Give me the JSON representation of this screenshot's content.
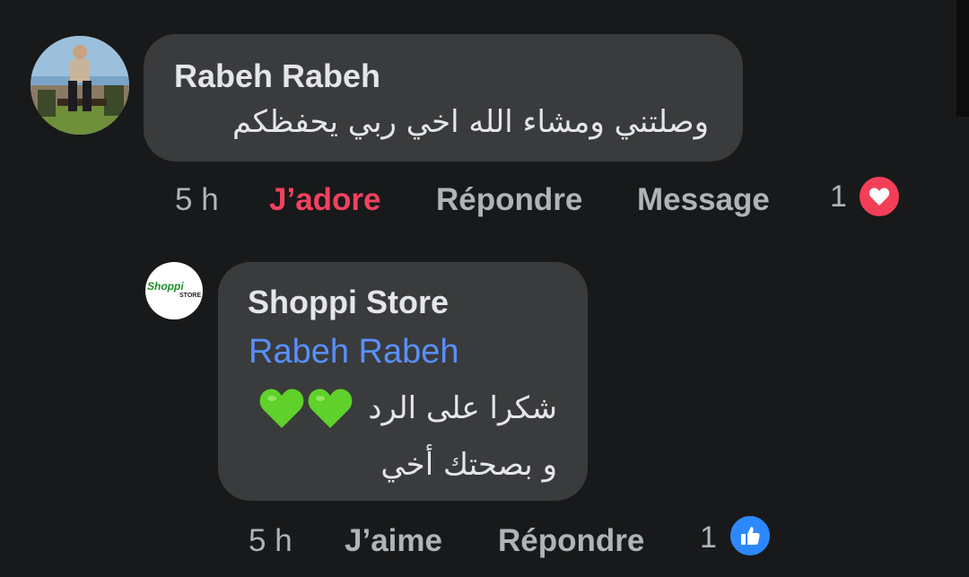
{
  "comment_1": {
    "author": "Rabeh Rabeh",
    "text": "وصلتني ومشاء الله اخي ربي يحفظكم",
    "time": "5 h",
    "reaction_label": "J’adore",
    "reply_label": "Répondre",
    "message_label": "Message",
    "reaction_count": "1",
    "reaction_icon": "heart-love-icon",
    "reaction_color": "#f33e58"
  },
  "comment_2": {
    "author": "Shoppi Store",
    "logo_text_main": "Shoppi",
    "logo_text_sub": "STORE",
    "mention": "Rabeh Rabeh",
    "text_line_1": "شكرا على الرد",
    "text_line_2": "و بصحتك أخي",
    "emoji": "green-heart-emoji",
    "time": "5 h",
    "reaction_label": "J’aime",
    "reply_label": "Répondre",
    "reaction_count": "1",
    "reaction_icon": "thumbs-up-like-icon",
    "reaction_color": "#2d88ff"
  },
  "colors": {
    "background": "#18191a",
    "bubble": "#3a3b3c",
    "text_primary": "#e4e6eb",
    "text_secondary": "#b0b3b8",
    "mention": "#5890ff",
    "love_active": "#f3425f"
  }
}
